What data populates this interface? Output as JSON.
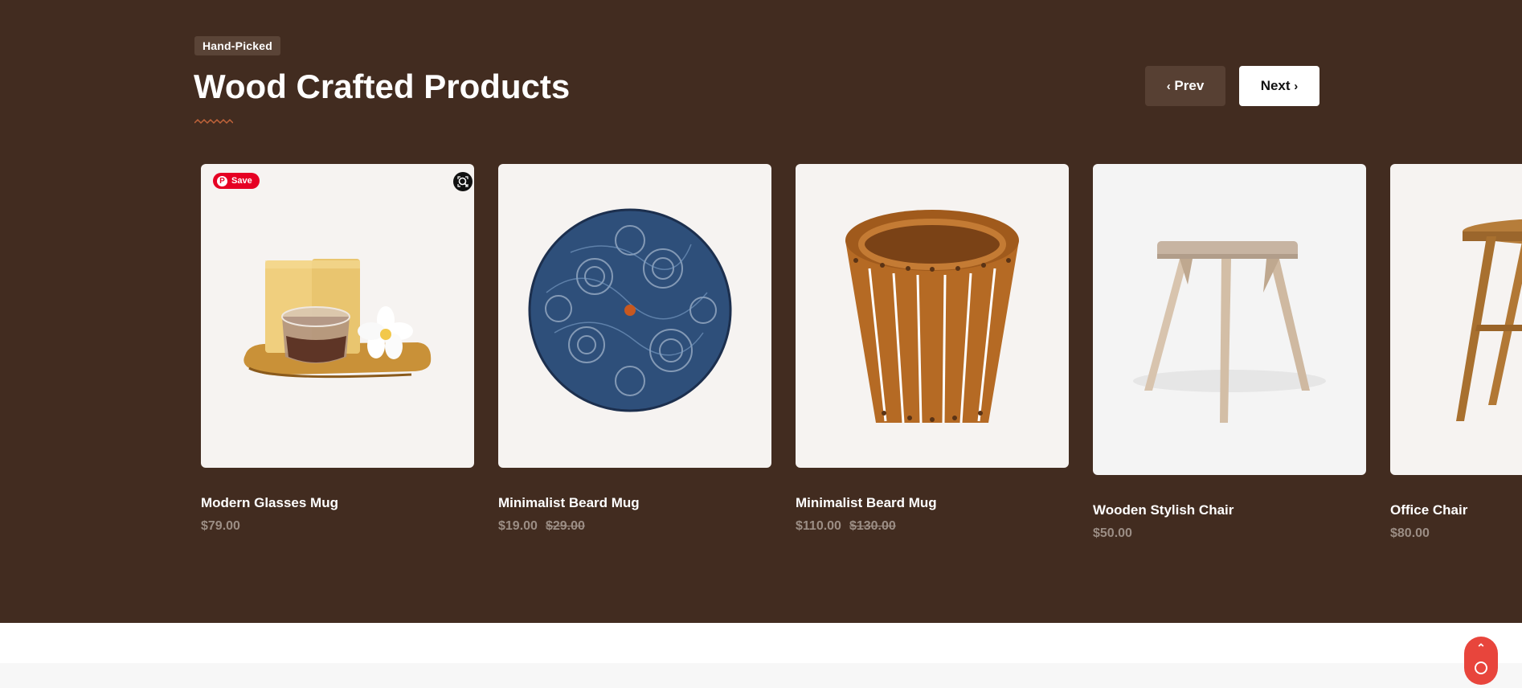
{
  "section": {
    "tag": "Hand-Picked",
    "title": "Wood Crafted Products",
    "prev_label": "Prev",
    "next_label": "Next"
  },
  "products": [
    {
      "name": "Modern Glasses Mug",
      "price": "$79.00",
      "old_price": ""
    },
    {
      "name": "Minimalist Beard Mug",
      "price": "$19.00",
      "old_price": "$29.00"
    },
    {
      "name": "Minimalist Beard Mug",
      "price": "$110.00",
      "old_price": "$130.00"
    },
    {
      "name": "Wooden Stylish Chair",
      "price": "$50.00",
      "old_price": ""
    },
    {
      "name": "Office Chair",
      "price": "$80.00",
      "old_price": ""
    }
  ],
  "overlay": {
    "pin_label": "Save",
    "pin_icon": "pinterest-icon",
    "lens_icon": "visual-search-icon"
  },
  "scroll_top_icon": "chevron-up-icon",
  "colors": {
    "background": "#422c20",
    "accent": "#e8453c",
    "pinterest": "#e60023"
  }
}
